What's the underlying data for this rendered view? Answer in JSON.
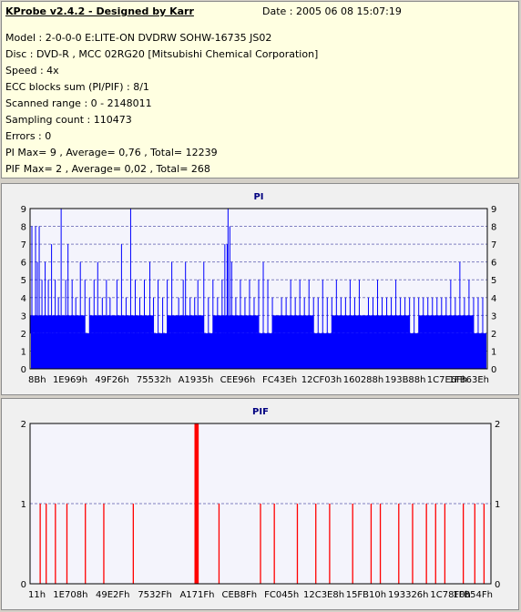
{
  "info": {
    "title": "KProbe v2.4.2 - Designed by Karr",
    "date": "Date : 2005 06 08 15:07:19",
    "lines": [
      "Model : 2-0-0-0 E:LITE-ON DVDRW SOHW-16735 JS02",
      "Disc : DVD-R , MCC 02RG20   [Mitsubishi Chemical Corporation]",
      "Speed : 4x",
      "ECC blocks sum (PI/PIF) : 8/1",
      "Scanned range : 0 - 2148011",
      "Sampling count : 110473",
      "Errors : 0",
      "PI Max= 9 , Average= 0,76 , Total= 12239",
      "PIF Max= 2 , Average= 0,02 , Total= 268"
    ]
  },
  "colors": {
    "pi": "#0000ff",
    "pif": "#ff0000",
    "grid": "#8080c0",
    "plot_bg": "#f4f4fc"
  },
  "chart_data": [
    {
      "type": "bar",
      "title": "PI",
      "ylim": [
        0,
        9
      ],
      "yticks": [
        0,
        1,
        2,
        3,
        4,
        5,
        6,
        7,
        8,
        9
      ],
      "xlim": [
        0,
        2148011
      ],
      "xticks": [
        "8Bh",
        "1E969h",
        "49F26h",
        "75532h",
        "A1935h",
        "CEE96h",
        "FC43Eh",
        "12CF03h",
        "160288h",
        "193B88h",
        "1C7E6Fh",
        "1FB63Eh"
      ],
      "baseline": 2,
      "base_level_3_ranges": [
        [
          0,
          0.12
        ],
        [
          0.13,
          0.27
        ],
        [
          0.3,
          0.38
        ],
        [
          0.4,
          0.5
        ],
        [
          0.53,
          0.62
        ],
        [
          0.66,
          0.83
        ],
        [
          0.85,
          0.97
        ]
      ],
      "spikes": [
        [
          0.004,
          8
        ],
        [
          0.012,
          8
        ],
        [
          0.016,
          6
        ],
        [
          0.02,
          8
        ],
        [
          0.026,
          5
        ],
        [
          0.033,
          6
        ],
        [
          0.04,
          5
        ],
        [
          0.047,
          7
        ],
        [
          0.055,
          5
        ],
        [
          0.062,
          4
        ],
        [
          0.068,
          9
        ],
        [
          0.078,
          5
        ],
        [
          0.083,
          7
        ],
        [
          0.092,
          5
        ],
        [
          0.1,
          4
        ],
        [
          0.11,
          6
        ],
        [
          0.12,
          5
        ],
        [
          0.13,
          4
        ],
        [
          0.14,
          5
        ],
        [
          0.148,
          6
        ],
        [
          0.158,
          4
        ],
        [
          0.167,
          5
        ],
        [
          0.175,
          4
        ],
        [
          0.19,
          5
        ],
        [
          0.2,
          7
        ],
        [
          0.21,
          4
        ],
        [
          0.22,
          9
        ],
        [
          0.23,
          5
        ],
        [
          0.24,
          4
        ],
        [
          0.25,
          5
        ],
        [
          0.262,
          6
        ],
        [
          0.27,
          4
        ],
        [
          0.28,
          5
        ],
        [
          0.29,
          4
        ],
        [
          0.3,
          5
        ],
        [
          0.31,
          6
        ],
        [
          0.325,
          4
        ],
        [
          0.335,
          5
        ],
        [
          0.34,
          6
        ],
        [
          0.35,
          4
        ],
        [
          0.36,
          4
        ],
        [
          0.367,
          5
        ],
        [
          0.38,
          6
        ],
        [
          0.39,
          4
        ],
        [
          0.4,
          5
        ],
        [
          0.41,
          4
        ],
        [
          0.42,
          5
        ],
        [
          0.426,
          7
        ],
        [
          0.431,
          7
        ],
        [
          0.433,
          9
        ],
        [
          0.437,
          8
        ],
        [
          0.441,
          6
        ],
        [
          0.45,
          4
        ],
        [
          0.46,
          5
        ],
        [
          0.47,
          4
        ],
        [
          0.48,
          5
        ],
        [
          0.49,
          4
        ],
        [
          0.5,
          5
        ],
        [
          0.51,
          6
        ],
        [
          0.52,
          5
        ],
        [
          0.53,
          4
        ],
        [
          0.55,
          4
        ],
        [
          0.56,
          4
        ],
        [
          0.57,
          5
        ],
        [
          0.58,
          4
        ],
        [
          0.59,
          5
        ],
        [
          0.6,
          4
        ],
        [
          0.61,
          5
        ],
        [
          0.62,
          4
        ],
        [
          0.63,
          4
        ],
        [
          0.64,
          5
        ],
        [
          0.65,
          4
        ],
        [
          0.66,
          4
        ],
        [
          0.67,
          5
        ],
        [
          0.68,
          4
        ],
        [
          0.69,
          4
        ],
        [
          0.7,
          5
        ],
        [
          0.71,
          4
        ],
        [
          0.72,
          5
        ],
        [
          0.74,
          4
        ],
        [
          0.75,
          4
        ],
        [
          0.76,
          5
        ],
        [
          0.77,
          4
        ],
        [
          0.78,
          4
        ],
        [
          0.79,
          4
        ],
        [
          0.8,
          5
        ],
        [
          0.81,
          4
        ],
        [
          0.82,
          4
        ],
        [
          0.83,
          4
        ],
        [
          0.84,
          4
        ],
        [
          0.85,
          4
        ],
        [
          0.86,
          4
        ],
        [
          0.87,
          4
        ],
        [
          0.88,
          4
        ],
        [
          0.89,
          4
        ],
        [
          0.9,
          4
        ],
        [
          0.91,
          4
        ],
        [
          0.92,
          5
        ],
        [
          0.93,
          4
        ],
        [
          0.94,
          6
        ],
        [
          0.95,
          4
        ],
        [
          0.96,
          5
        ],
        [
          0.97,
          4
        ],
        [
          0.98,
          4
        ],
        [
          0.99,
          4
        ]
      ]
    },
    {
      "type": "bar",
      "title": "PIF",
      "ylim": [
        0,
        2
      ],
      "yticks": [
        0,
        1,
        2
      ],
      "xlim": [
        0,
        2148011
      ],
      "xticks": [
        "11h",
        "1E708h",
        "49E2Fh",
        "7532Fh",
        "A171Fh",
        "CEB8Fh",
        "FC045h",
        "12C3E8h",
        "15FB10h",
        "193326h",
        "1C78F0h",
        "1FB54Fh"
      ],
      "spikes": [
        [
          0.022,
          1
        ],
        [
          0.055,
          1
        ],
        [
          0.16,
          1
        ],
        [
          0.224,
          1
        ],
        [
          0.358,
          2
        ],
        [
          0.36,
          2
        ],
        [
          0.362,
          2
        ],
        [
          0.364,
          2
        ],
        [
          0.41,
          1
        ],
        [
          0.5,
          1
        ],
        [
          0.53,
          1
        ],
        [
          0.58,
          1
        ],
        [
          0.62,
          1
        ],
        [
          0.65,
          1
        ],
        [
          0.7,
          1
        ],
        [
          0.74,
          1
        ],
        [
          0.76,
          1
        ],
        [
          0.8,
          1
        ],
        [
          0.83,
          1
        ],
        [
          0.86,
          1
        ],
        [
          0.88,
          1
        ],
        [
          0.9,
          1
        ],
        [
          0.94,
          1
        ],
        [
          0.965,
          1
        ],
        [
          0.985,
          1
        ],
        [
          0.035,
          1
        ],
        [
          0.08,
          1
        ],
        [
          0.12,
          1
        ]
      ]
    }
  ]
}
